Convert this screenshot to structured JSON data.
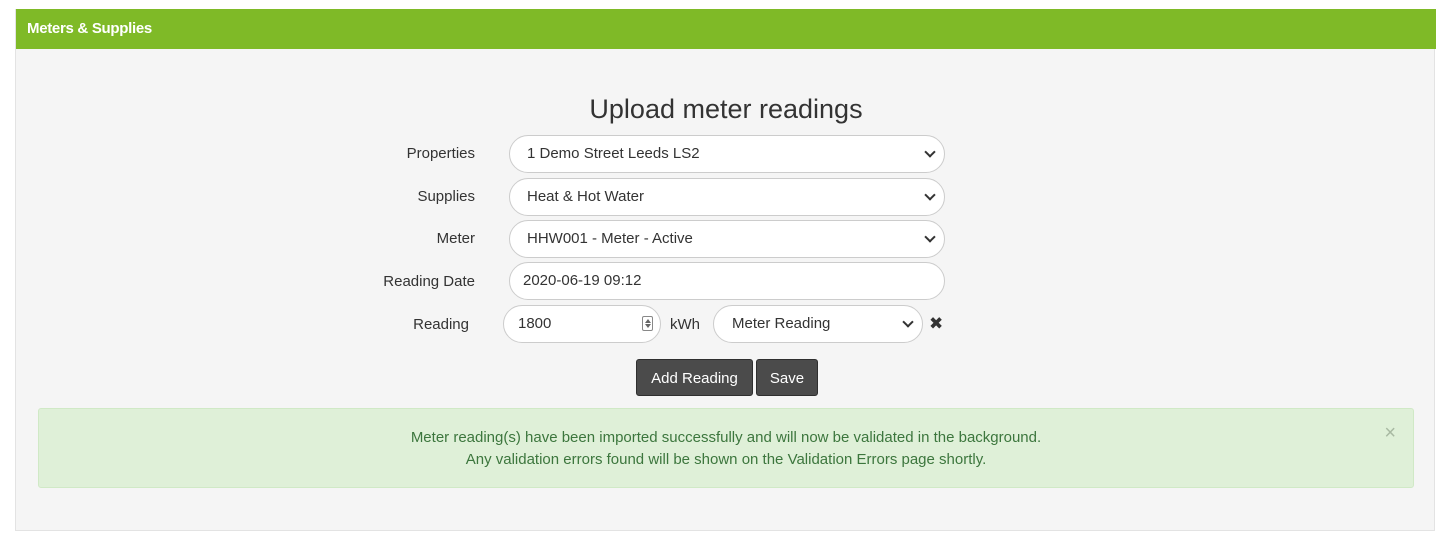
{
  "panel": {
    "title": "Meters & Supplies"
  },
  "form": {
    "title": "Upload meter readings",
    "properties": {
      "label": "Properties",
      "value": "1 Demo Street Leeds LS2"
    },
    "supplies": {
      "label": "Supplies",
      "value": "Heat & Hot Water"
    },
    "meter": {
      "label": "Meter",
      "value": "HHW001 - Meter - Active"
    },
    "reading_date": {
      "label": "Reading Date",
      "value": "2020-06-19 09:12"
    },
    "reading": {
      "label": "Reading",
      "value": "1800",
      "unit": "kWh",
      "type_value": "Meter Reading"
    },
    "buttons": {
      "add_reading": "Add Reading",
      "save": "Save"
    }
  },
  "alert": {
    "line1": "Meter reading(s) have been imported successfully and will now be validated in the background.",
    "line2": "Any validation errors found will be shown on the Validation Errors page shortly.",
    "close": "×"
  },
  "icons": {
    "remove": "✖"
  },
  "colors": {
    "header": "#7fba27",
    "button": "#4b4b4b",
    "alert_bg": "#dff0d8",
    "alert_text": "#3c763d"
  }
}
